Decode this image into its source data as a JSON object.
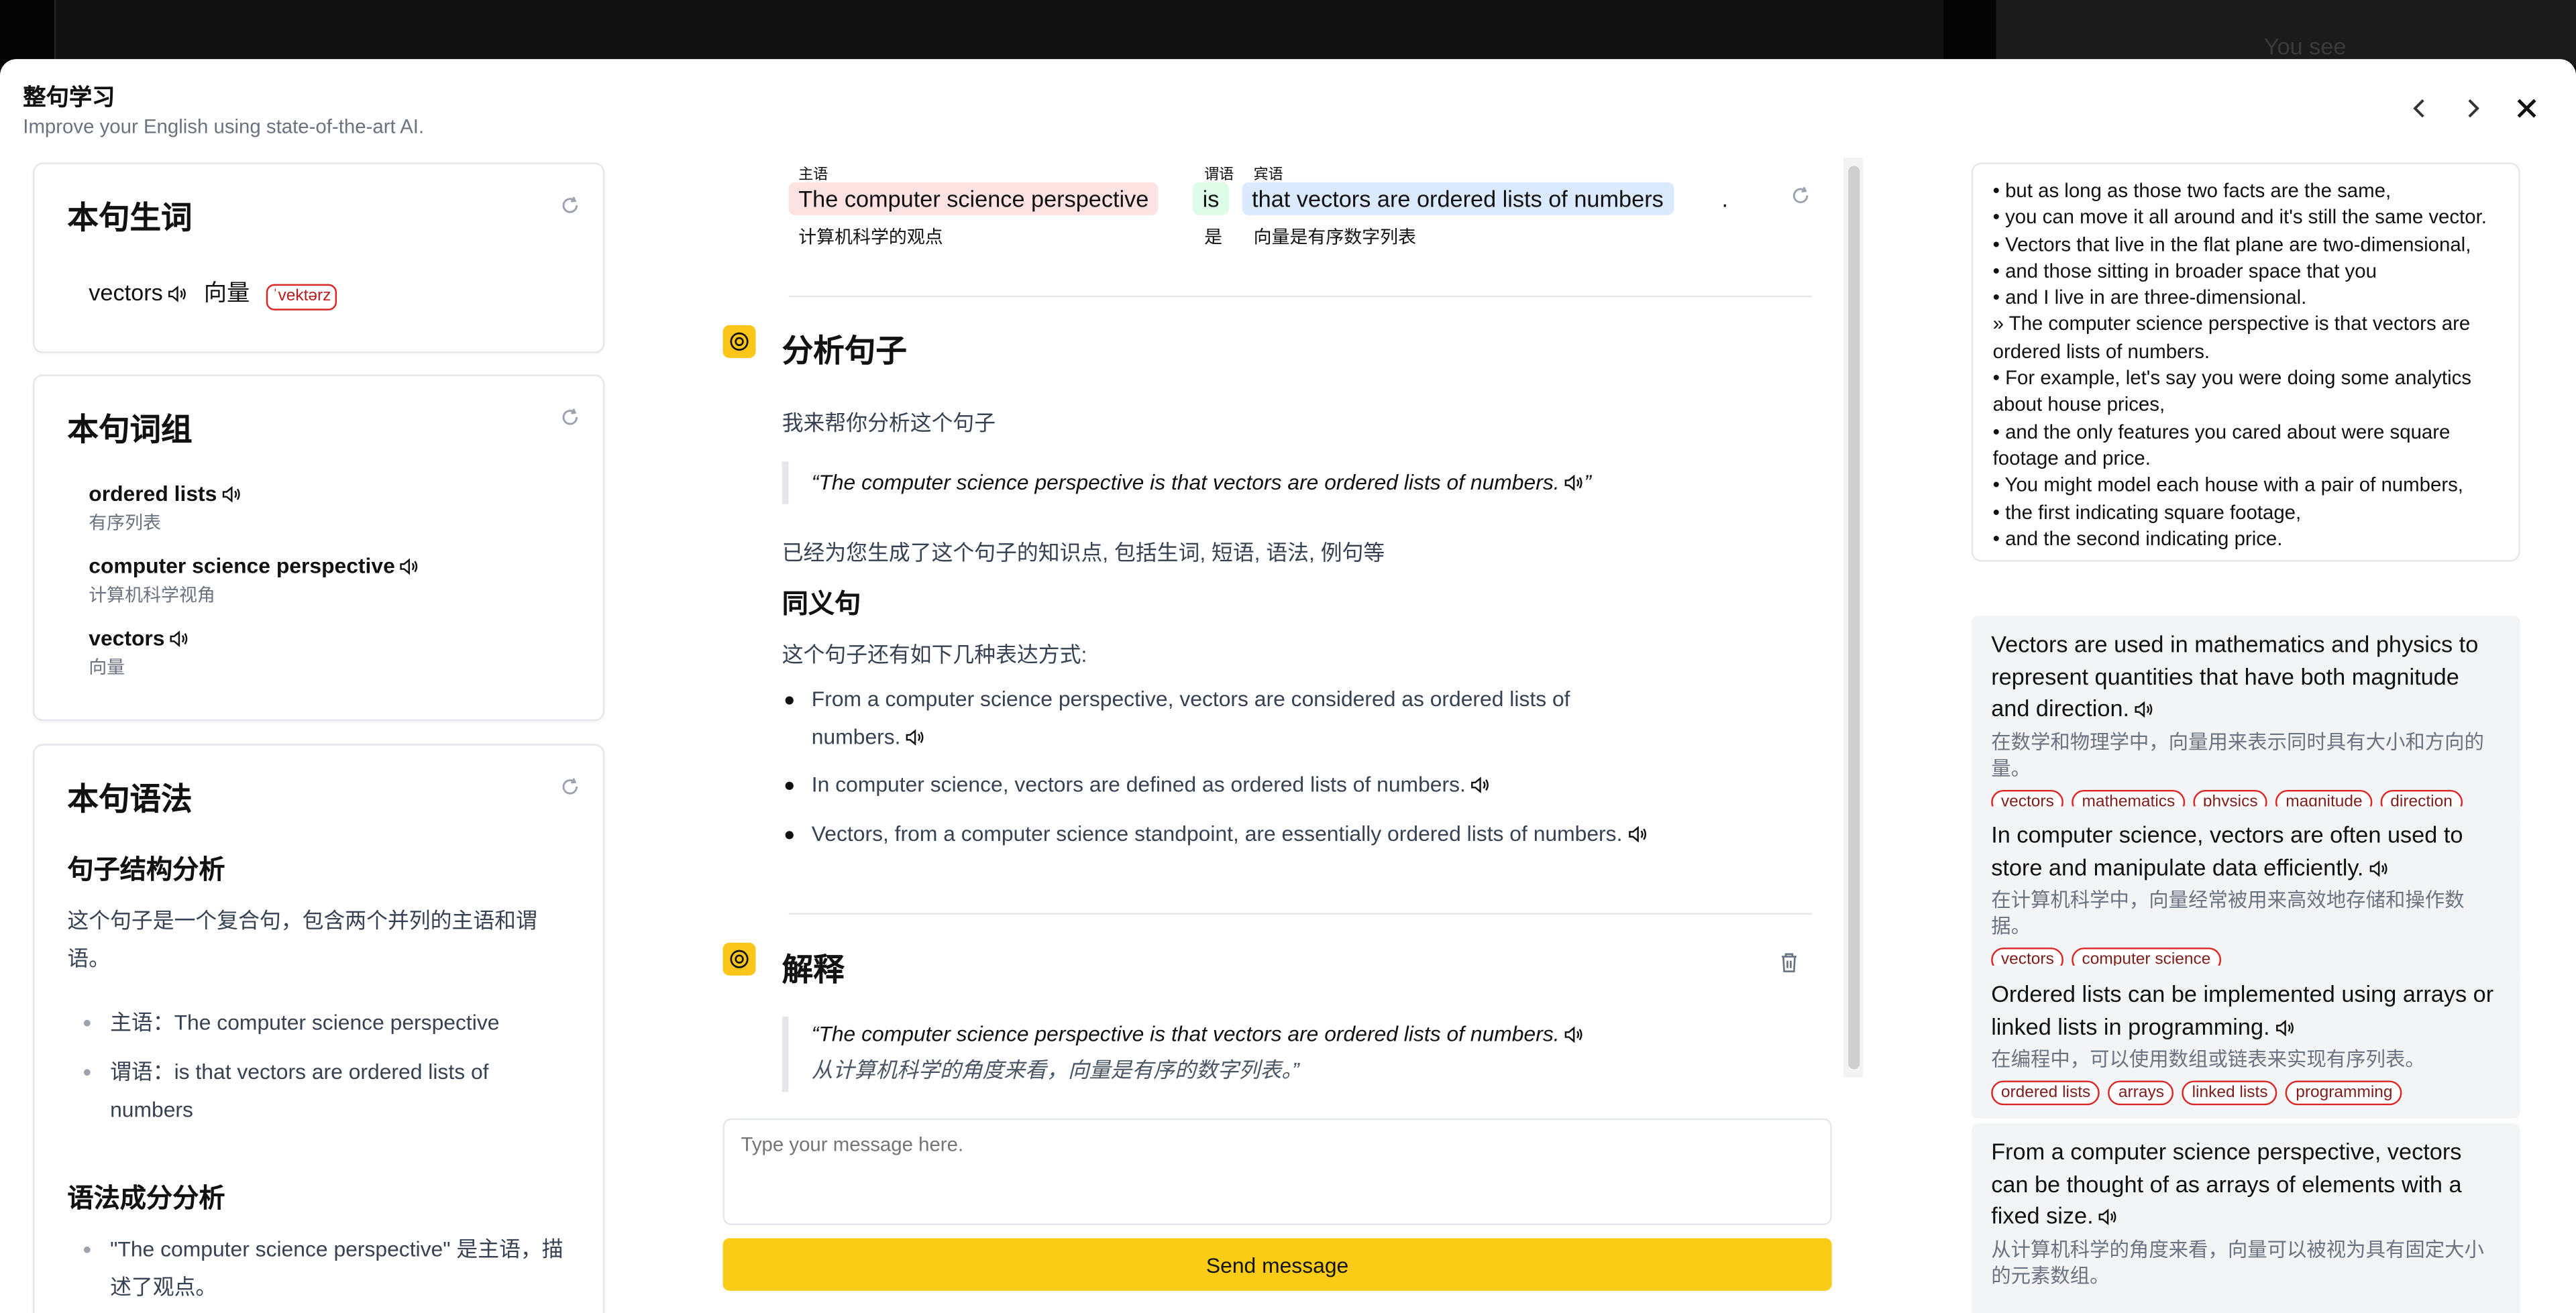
{
  "background": {
    "hint_text": "You see"
  },
  "modal": {
    "title": "整句学习",
    "subtitle": "Improve your English using state-of-the-art AI."
  },
  "vocab": {
    "title": "本句生词",
    "word": "vectors",
    "meaning": "向量",
    "phonetic": "ˈvektərz"
  },
  "phrases": {
    "title": "本句词组",
    "items": [
      {
        "en": "ordered lists",
        "zh": "有序列表"
      },
      {
        "en": "computer science perspective",
        "zh": "计算机科学视角"
      },
      {
        "en": "vectors",
        "zh": "向量"
      }
    ]
  },
  "grammar": {
    "title": "本句语法",
    "h_structure": "句子结构分析",
    "structure_text": "这个句子是一个复合句，包含两个并列的主语和谓语。",
    "bullets": [
      "主语：The computer science perspective",
      "谓语：is that vectors are ordered lists of numbers"
    ],
    "h_components": "语法成分分析",
    "component_text": "\"The computer science perspective\" 是主语，描述了观点。"
  },
  "sentence": {
    "subject_label": "主语",
    "subject": "The computer science perspective",
    "subject_zh": "计算机科学的观点",
    "predicate_label": "谓语",
    "predicate": "is",
    "predicate_zh": "是",
    "object_label": "宾语",
    "object": "that vectors are ordered lists of numbers",
    "object_zh": "向量是有序数字列表",
    "period": "."
  },
  "analysis": {
    "title": "分析句子",
    "intro": "我来帮你分析这个句子",
    "quote_open": "“The computer science perspective is that vectors are ordered lists of numbers.",
    "quote_close": "”",
    "generated": "已经为您生成了这个句子的知识点, 包括生词, 短语, 语法, 例句等",
    "synonym_title": "同义句",
    "synonym_intro": "这个句子还有如下几种表达方式:",
    "synonyms": [
      "From a computer science perspective, vectors are considered as ordered lists of numbers.",
      "In computer science, vectors are defined as ordered lists of numbers.",
      "Vectors, from a computer science standpoint, are essentially ordered lists of numbers."
    ]
  },
  "explanation": {
    "title": "解释",
    "quote_en": "“The computer science perspective is that vectors are ordered lists of numbers.",
    "quote_zh": "从计算机科学的角度来看，向量是有序的数字列表。”"
  },
  "chat": {
    "placeholder": "Type your message here.",
    "send_label": "Send message"
  },
  "transcript": [
    "•  but as long as those two facts are the same,",
    "•  you can move it all around and it's still the same vector.",
    "•  Vectors that live in the flat plane are two-dimensional,",
    "•  and those sitting in broader space that you",
    "•  and I live in are three-dimensional.",
    "»  The computer science perspective is that vectors are ordered lists of numbers.",
    "•  For example, let's say you were doing some analytics about house prices,",
    "•  and the only features you cared about were square footage and price.",
    "•  You might model each house with a pair of numbers,",
    "•  the first indicating square footage,",
    "•  and the second indicating price."
  ],
  "examples": [
    {
      "en": "Vectors are used in mathematics and physics to represent quantities that have both magnitude and direction.",
      "zh": "在数学和物理学中，向量用来表示同时具有大小和方向的量。",
      "tags": [
        "vectors",
        "mathematics",
        "physics",
        "magnitude",
        "direction"
      ]
    },
    {
      "en": "In computer science, vectors are often used to store and manipulate data efficiently.",
      "zh": "在计算机科学中，向量经常被用来高效地存储和操作数据。",
      "tags": [
        "vectors",
        "computer science"
      ]
    },
    {
      "en": "Ordered lists can be implemented using arrays or linked lists in programming.",
      "zh": "在编程中，可以使用数组或链表来实现有序列表。",
      "tags": [
        "ordered lists",
        "arrays",
        "linked lists",
        "programming"
      ]
    },
    {
      "en": "From a computer science perspective, vectors can be thought of as arrays of elements with a fixed size.",
      "zh": "从计算机科学的角度来看，向量可以被视为具有固定大小的元素数组。",
      "tags": []
    }
  ],
  "colors": {
    "accent": "#facc15",
    "subject_bg": "#fde2e2",
    "predicate_bg": "#dcfce7",
    "object_bg": "#dbeafe",
    "tag_border": "#dc2626"
  }
}
